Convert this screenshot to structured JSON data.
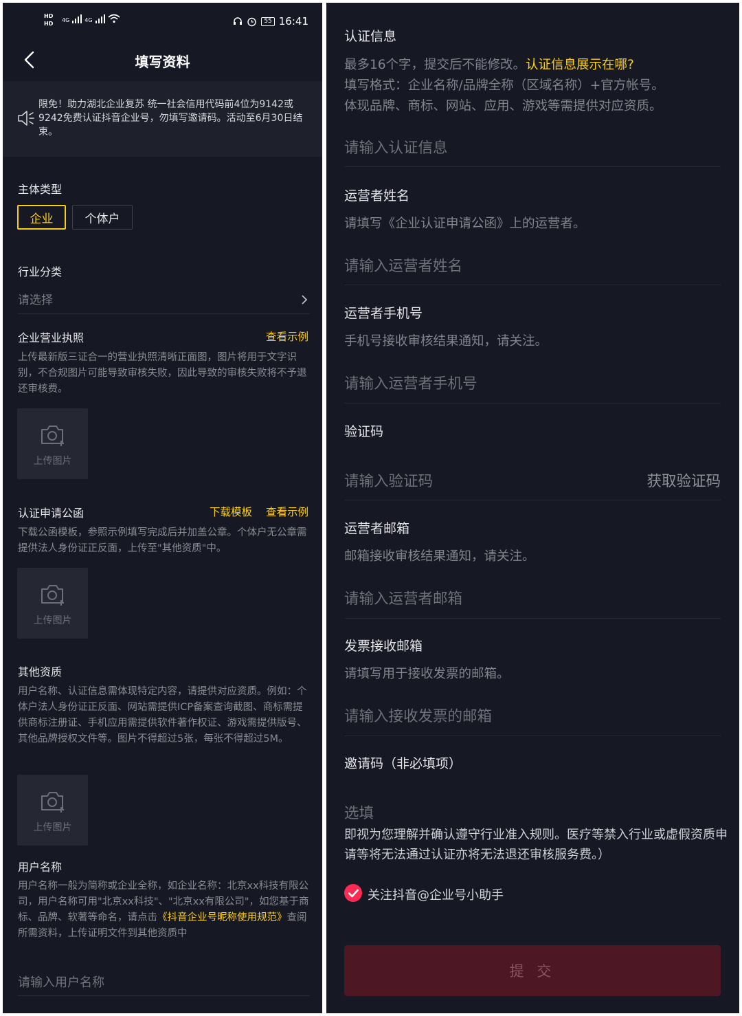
{
  "status_bar": {
    "hd1": "HD",
    "hd2": "HD",
    "net1": "4G",
    "net2": "4G",
    "battery": "55",
    "time": "16:41"
  },
  "nav": {
    "title": "填写资料"
  },
  "notice": {
    "text": "限免！助力湖北企业复苏 统一社会信用代码前4位为9142或9242免费认证抖音企业号，勿填写邀请码。活动至6月30日结束。"
  },
  "entity_type": {
    "label": "主体类型",
    "options": [
      "企业",
      "个体户"
    ],
    "selected": "企业"
  },
  "industry": {
    "label": "行业分类",
    "placeholder": "请选择"
  },
  "license": {
    "label": "企业营业执照",
    "example_link": "查看示例",
    "desc": "上传最新版三证合一的营业执照清晰正面图，图片将用于文字识别，不合规图片可能导致审核失败，因此导致的审核失败将不予退还审核费。",
    "upload_label": "上传图片"
  },
  "letter": {
    "label": "认证申请公函",
    "template_link": "下载模板",
    "example_link": "查看示例",
    "desc": "下载公函模板，参照示例填写完成后并加盖公章。个体户无公章需提供法人身份证正反面，上传至\"其他资质\"中。",
    "upload_label": "上传图片"
  },
  "other": {
    "label": "其他资质",
    "desc": "用户名称、认证信息需体现特定内容，请提供对应资质。例如：个体户法人身份证正反面、网站需提供ICP备案查询截图、商标需提供商标注册证、手机应用需提供软件著作权证、游戏需提供版号、其他品牌授权文件等。图片不得超过5张，每张不得超过5M。",
    "upload_label": "上传图片"
  },
  "username": {
    "label": "用户名称",
    "desc_pre": "用户名称一般为简称或企业全称，如企业名称：北京xx科技有限公司，用户名称可用\"北京xx科技\"、\"北京xx有限公司\"，如您基于商标、品牌、软著等命名，请点击",
    "desc_link": "《抖音企业号昵称使用规范》",
    "desc_post": "查阅所需资料，上传证明文件到其他资质中",
    "placeholder": "请输入用户名称"
  },
  "auth_info": {
    "label": "认证信息",
    "desc_line1_pre": "最多16个字，提交后不能修改。",
    "desc_line1_link": "认证信息展示在哪?",
    "desc_line2": "填写格式：企业名称/品牌全称（区域名称）+官方帐号。",
    "desc_line3": "体现品牌、商标、网站、应用、游戏等需提供对应资质。",
    "placeholder": "请输入认证信息"
  },
  "operator_name": {
    "label": "运营者姓名",
    "desc": "请填写《企业认证申请公函》上的运营者。",
    "placeholder": "请输入运营者姓名"
  },
  "operator_phone": {
    "label": "运营者手机号",
    "desc": "手机号接收审核结果通知，请关注。",
    "placeholder": "请输入运营者手机号"
  },
  "verify_code": {
    "label": "验证码",
    "placeholder": "请输入验证码",
    "get_code": "获取验证码"
  },
  "operator_email": {
    "label": "运营者邮箱",
    "desc": "邮箱接收审核结果通知，请关注。",
    "placeholder": "请输入运营者邮箱"
  },
  "invoice_email": {
    "label": "发票接收邮箱",
    "desc": "请填写用于接收发票的邮箱。",
    "placeholder": "请输入接收发票的邮箱"
  },
  "invite": {
    "label": "邀请码（非必填项）",
    "placeholder": "选填"
  },
  "agreement": {
    "text": "即视为您理解并确认遵守行业准入规则。医疗等禁入行业或虚假资质申请等将无法通过认证亦将无法退还审核服务费。）"
  },
  "follow": {
    "label": "关注抖音@企业号小助手",
    "checked": true
  },
  "submit": {
    "label": "提 交"
  },
  "colors": {
    "accent": "#face15",
    "brand": "#fe2c55",
    "background": "#161823"
  }
}
